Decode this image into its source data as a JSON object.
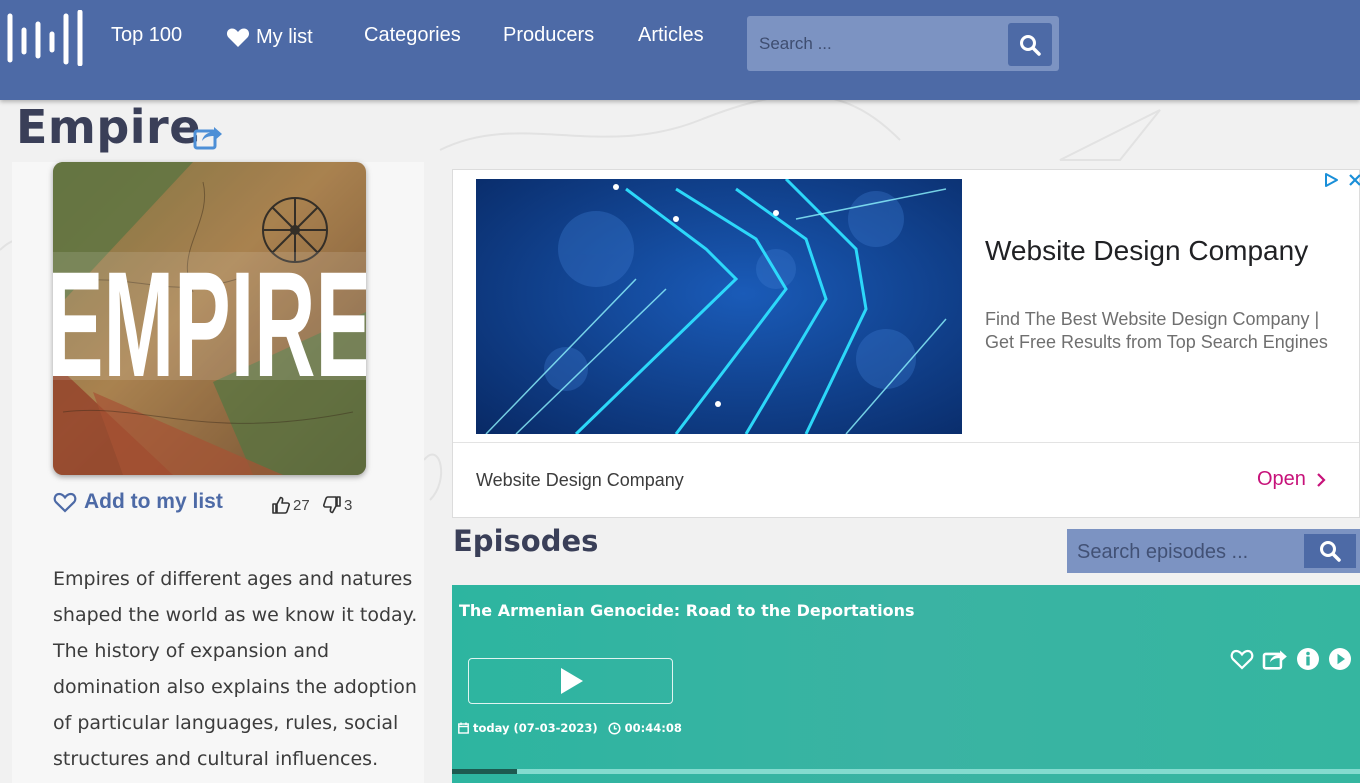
{
  "header": {
    "nav": {
      "top100": "Top 100",
      "mylist": "My list",
      "categories": "Categories",
      "producers": "Producers",
      "articles": "Articles"
    },
    "search": {
      "placeholder": "Search ..."
    },
    "colors": {
      "bar": "#4d6aa6",
      "search_bg": "#7c93c2"
    }
  },
  "podcast": {
    "title": "Empire",
    "cover_text": "EMPIRE",
    "add_to_list": "Add to my list",
    "likes": "27",
    "dislikes": "3",
    "description": "Empires of different ages and natures shaped the world as we know it today. The history of expansion and domination also explains the adoption of particular languages, rules, social structures and cultural influences."
  },
  "ad": {
    "title": "Website Design Company",
    "text": "Find The Best Website Design Company | Get Free Results from Top Search Engines",
    "footer_name": "Website Design Company",
    "open_label": "Open",
    "accent": "#c7127a"
  },
  "episodes": {
    "heading": "Episodes",
    "search_placeholder": "Search episodes ...",
    "items": [
      {
        "title": "The Armenian Genocide: Road to the Deportations",
        "date": "today (07-03-2023)",
        "duration": "00:44:08",
        "progress": 0.072,
        "color": "#2db5a0"
      }
    ]
  },
  "icons": {
    "logo": "bars-logo-icon",
    "heart": "heart-icon",
    "search": "search-icon",
    "share": "share-icon",
    "thumbs_up": "thumbs-up-icon",
    "thumbs_down": "thumbs-down-icon",
    "play": "play-icon",
    "info": "info-icon",
    "calendar": "calendar-icon",
    "clock": "clock-icon"
  }
}
